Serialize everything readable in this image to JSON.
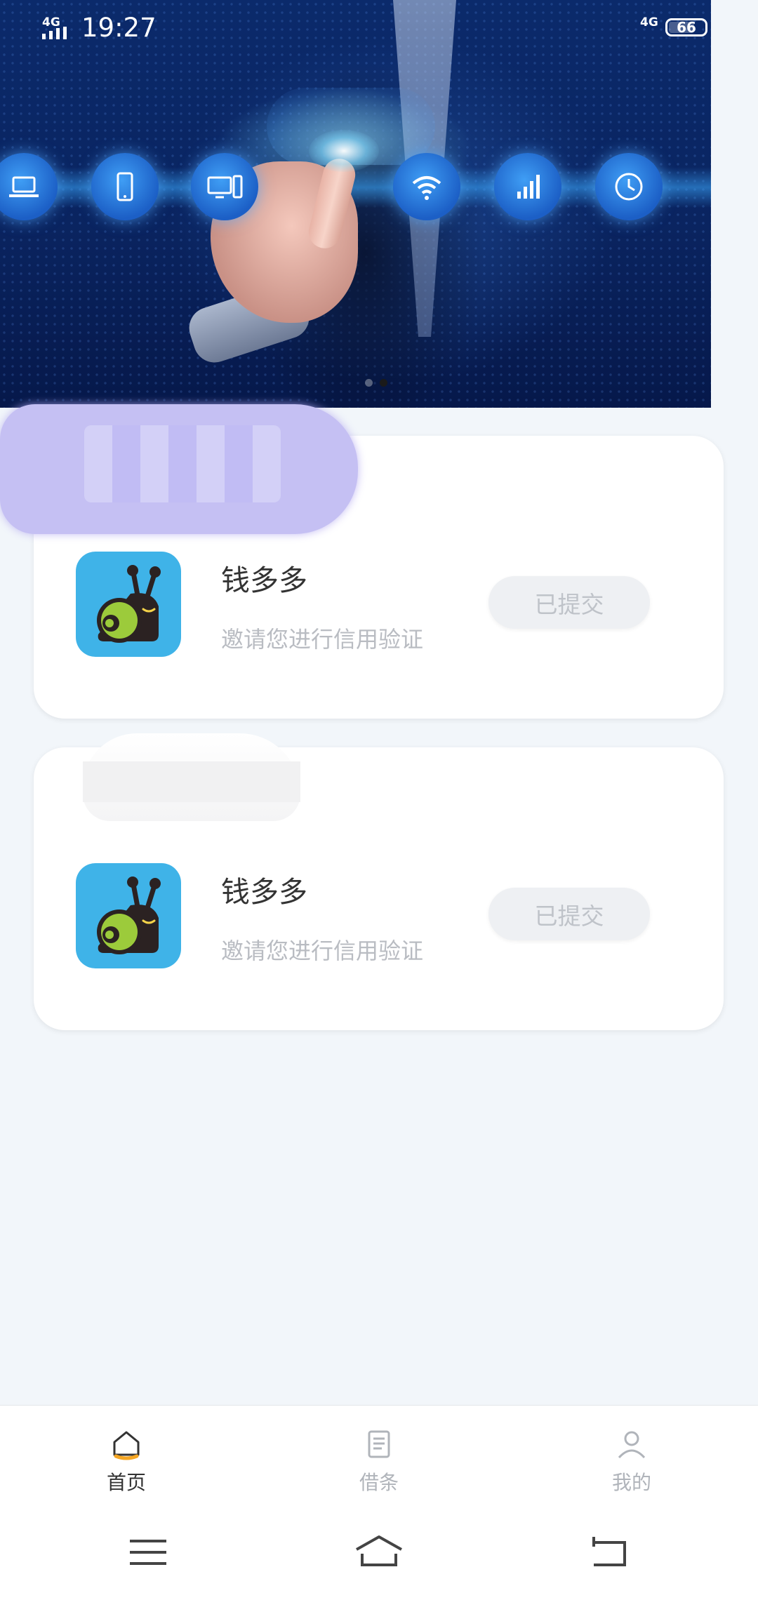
{
  "status_bar": {
    "network_left": "4G",
    "time": "19:27",
    "network_right": "4G",
    "battery": "66"
  },
  "banner": {
    "icons": [
      "laptop-icon",
      "phone-icon",
      "desktop-icon",
      "wifi-icon",
      "signal-icon",
      "clock-icon"
    ],
    "pager": {
      "count": 2,
      "active_index": 1
    }
  },
  "cards": [
    {
      "app_name": "钱多多",
      "description": "邀请您进行信用验证",
      "button_label": "已提交"
    },
    {
      "app_name": "钱多多",
      "description": "邀请您进行信用验证",
      "button_label": "已提交"
    }
  ],
  "bottom_nav": {
    "items": [
      {
        "label": "首页",
        "icon": "home-icon",
        "active": true
      },
      {
        "label": "借条",
        "icon": "document-icon",
        "active": false
      },
      {
        "label": "我的",
        "icon": "user-icon",
        "active": false
      }
    ]
  },
  "system_bar": {
    "buttons": [
      "menu-icon",
      "home-icon",
      "back-icon"
    ]
  },
  "colors": {
    "background": "#f2f6fa",
    "card": "#ffffff",
    "app_icon_bg": "#3fb3e8",
    "nav_active_accent": "#f5a623",
    "text_primary": "#333333",
    "text_muted": "#b9bcc2"
  }
}
